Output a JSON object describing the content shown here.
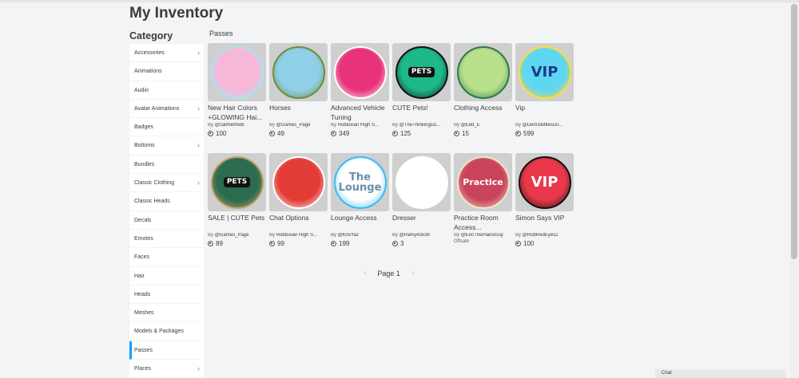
{
  "page": {
    "title": "My Inventory"
  },
  "category": {
    "heading": "Category",
    "items": [
      {
        "label": "Accessories",
        "chevron": true
      },
      {
        "label": "Animations",
        "chevron": false
      },
      {
        "label": "Audio",
        "chevron": false
      },
      {
        "label": "Avatar Animations",
        "chevron": true
      },
      {
        "label": "Badges",
        "chevron": false
      },
      {
        "label": "Bottoms",
        "chevron": true
      },
      {
        "label": "Bundles",
        "chevron": false
      },
      {
        "label": "Classic Clothing",
        "chevron": true
      },
      {
        "label": "Classic Heads",
        "chevron": false
      },
      {
        "label": "Decals",
        "chevron": false
      },
      {
        "label": "Emotes",
        "chevron": false
      },
      {
        "label": "Faces",
        "chevron": false
      },
      {
        "label": "Hair",
        "chevron": false
      },
      {
        "label": "Heads",
        "chevron": false
      },
      {
        "label": "Meshes",
        "chevron": false
      },
      {
        "label": "Models & Packages",
        "chevron": false
      },
      {
        "label": "Passes",
        "chevron": false,
        "active": true
      },
      {
        "label": "Places",
        "chevron": true
      }
    ],
    "chevron_glyph": "›"
  },
  "section": {
    "title": "Passes"
  },
  "by_prefix": "By",
  "items": [
    {
      "name": "New Hair Colors +GLOWING Hai...",
      "creator": "@callmehbob",
      "price": "100",
      "thumb_text": "",
      "colors": [
        "#f7b8d8",
        "#a8e4f0"
      ]
    },
    {
      "name": "Horses",
      "creator": "@Games_Page",
      "price": "49",
      "thumb_text": "",
      "colors": [
        "#8fd0e8",
        "#6b8e3d"
      ]
    },
    {
      "name": "Advanced Vehicle Tuning",
      "creator": "Robloxian High S...",
      "price": "349",
      "thumb_text": "",
      "colors": [
        "#e8327a",
        "#ffffff"
      ]
    },
    {
      "name": "CUTE Pets!",
      "creator": "@TheThinkingDu...",
      "price": "125",
      "thumb_text": "PETS",
      "colors": [
        "#1db98a",
        "#111111"
      ]
    },
    {
      "name": "Clothing Access",
      "creator": "@Edd_E",
      "price": "15",
      "thumb_text": "",
      "colors": [
        "#b9e08c",
        "#2f7a4a"
      ]
    },
    {
      "name": "Vip",
      "creator": "@DemSkittlesDo...",
      "price": "599",
      "thumb_text": "VIP",
      "colors": [
        "#5fd6f2",
        "#ffde32"
      ]
    },
    {
      "name": "SALE | CUTE Pets",
      "creator": "@Games_Page",
      "price": "89",
      "thumb_text": "PETS",
      "colors": [
        "#2b6b4f",
        "#c4a26a"
      ]
    },
    {
      "name": "Chat Options",
      "creator": "Robloxian High S...",
      "price": "99",
      "thumb_text": "",
      "colors": [
        "#e33b35",
        "#ffffff"
      ]
    },
    {
      "name": "Lounge Access",
      "creator": "@KrixYaz",
      "price": "199",
      "thumb_text": "The Lounge",
      "colors": [
        "#ffffff",
        "#3bbcf0"
      ]
    },
    {
      "name": "Dresser",
      "creator": "@Parky43536",
      "price": "3",
      "thumb_text": "",
      "colors": [
        "#ffffff",
        "#ffffff"
      ]
    },
    {
      "name": "Practice Room Access...",
      "creator": "@EricThePianoGuy",
      "price": "",
      "offsale": "Offsale",
      "thumb_text": "Practice",
      "colors": [
        "#c9445a",
        "#f0e6c8"
      ]
    },
    {
      "name": "Simon Says VIP",
      "creator": "@RobRedEyes2",
      "price": "100",
      "thumb_text": "VIP",
      "colors": [
        "#e8384a",
        "#111111"
      ]
    }
  ],
  "pager": {
    "prev": "‹",
    "label": "Page 1",
    "next": "›"
  },
  "chat": {
    "label": "Chat"
  }
}
